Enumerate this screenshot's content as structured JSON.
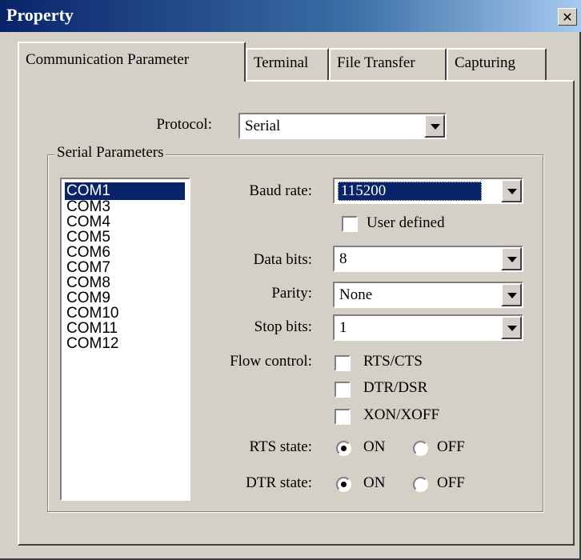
{
  "window": {
    "title": "Property"
  },
  "tabs": [
    {
      "label": "Communication Parameter",
      "active": true
    },
    {
      "label": "Terminal",
      "active": false
    },
    {
      "label": "File Transfer",
      "active": false
    },
    {
      "label": "Capturing",
      "active": false
    }
  ],
  "protocol": {
    "label": "Protocol:",
    "value": "Serial"
  },
  "serial": {
    "group_label": "Serial Parameters",
    "ports": [
      "COM1",
      "COM3",
      "COM4",
      "COM5",
      "COM6",
      "COM7",
      "COM8",
      "COM9",
      "COM10",
      "COM11",
      "COM12"
    ],
    "selected_port": "COM1",
    "baud_rate": {
      "label": "Baud rate:",
      "value": "115200"
    },
    "user_defined": {
      "label": "User defined",
      "checked": false
    },
    "data_bits": {
      "label": "Data bits:",
      "value": "8"
    },
    "parity": {
      "label": "Parity:",
      "value": "None"
    },
    "stop_bits": {
      "label": "Stop bits:",
      "value": "1"
    },
    "flow_control": {
      "label": "Flow control:",
      "options": [
        {
          "label": "RTS/CTS",
          "checked": false
        },
        {
          "label": "DTR/DSR",
          "checked": false
        },
        {
          "label": "XON/XOFF",
          "checked": false
        }
      ]
    },
    "rts_state": {
      "label": "RTS state:",
      "on_label": "ON",
      "off_label": "OFF",
      "value": "ON"
    },
    "dtr_state": {
      "label": "DTR state:",
      "on_label": "ON",
      "off_label": "OFF",
      "value": "ON"
    }
  },
  "colors": {
    "face": "#d4d0c8",
    "titlebar": "#0a246a",
    "selection": "#0a246a"
  }
}
